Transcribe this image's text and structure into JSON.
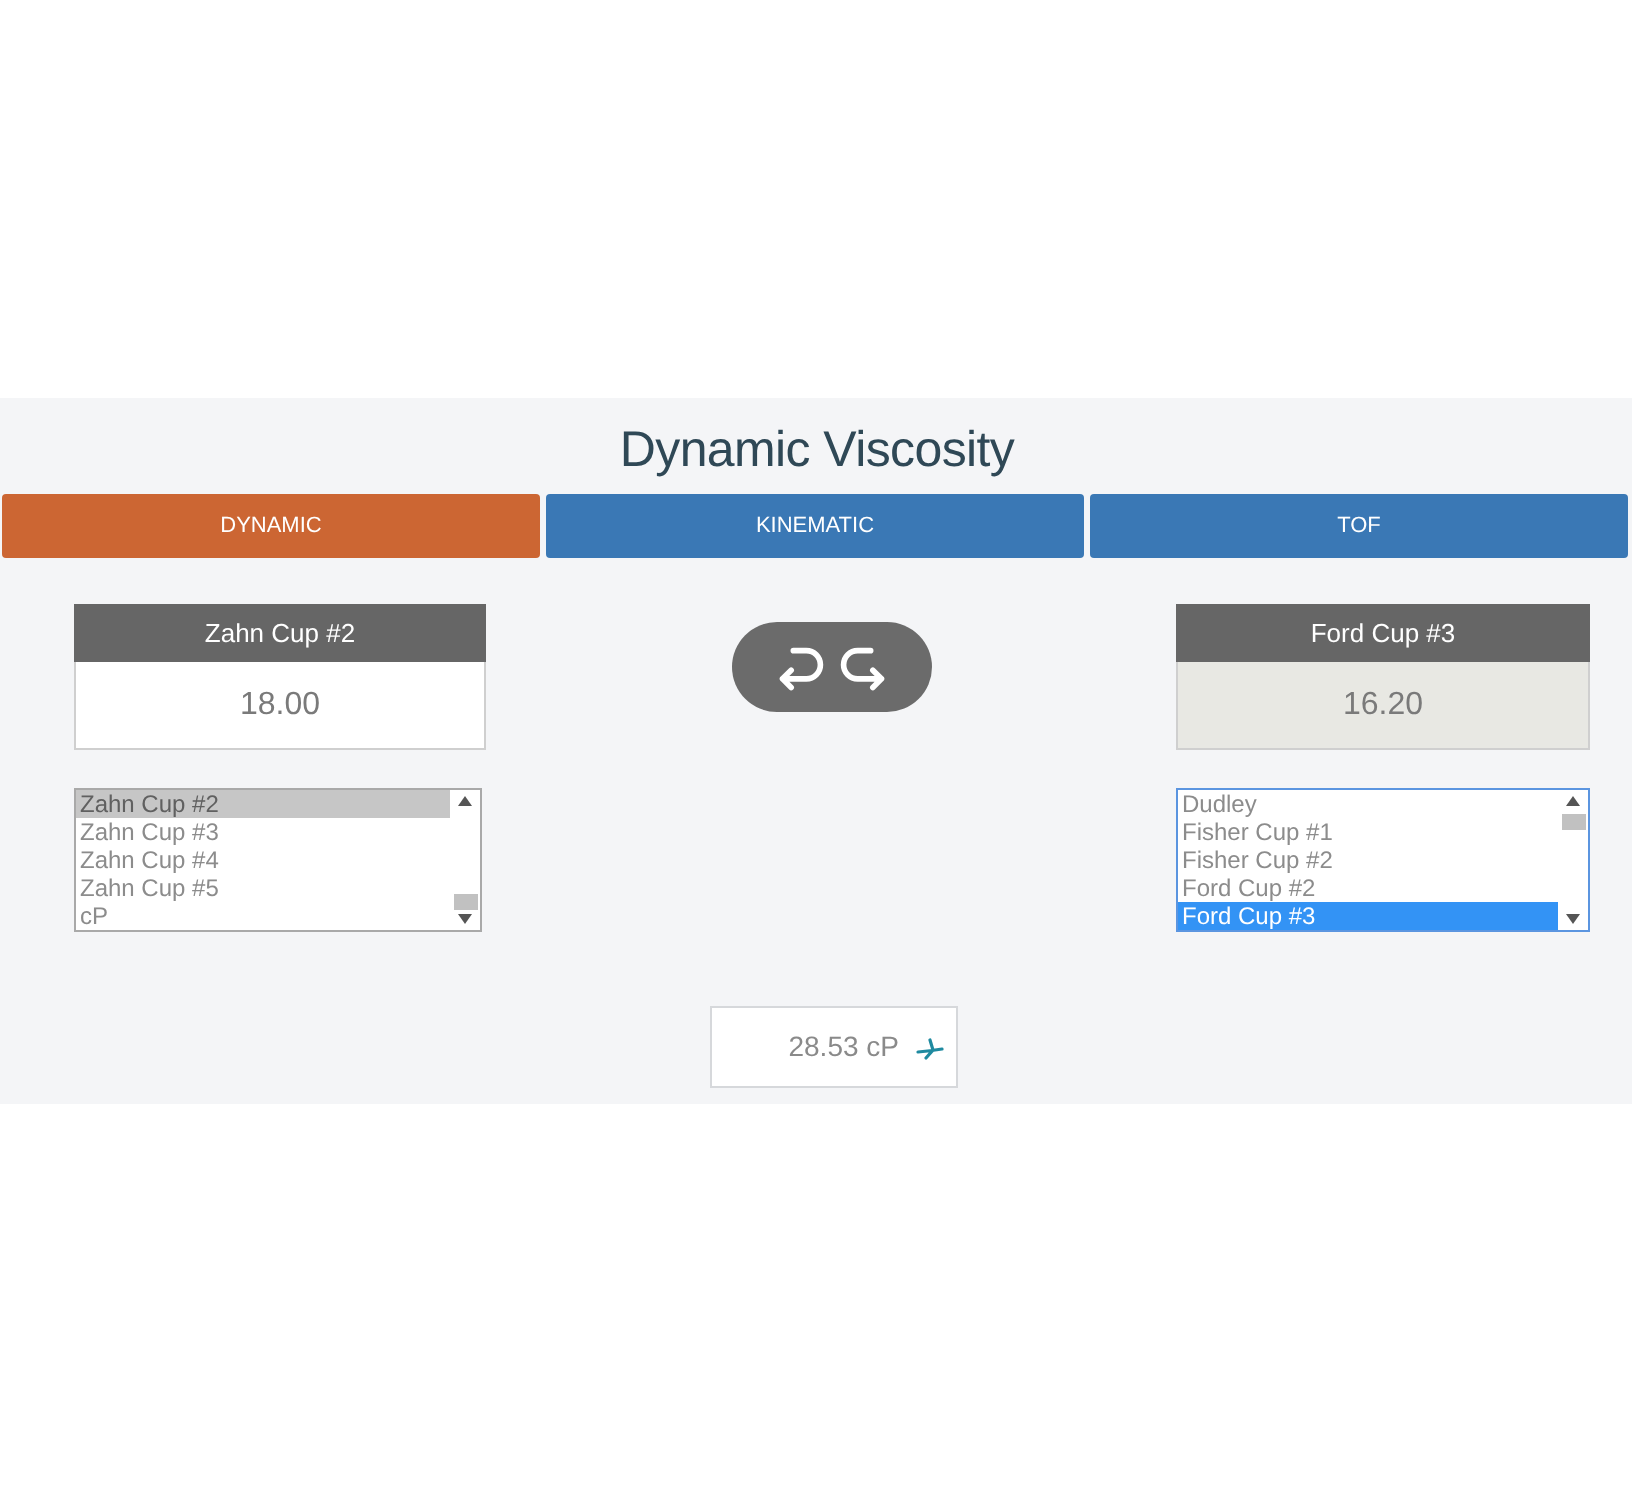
{
  "title": "Dynamic Viscosity",
  "tabs": [
    {
      "label": "DYNAMIC",
      "selected": true
    },
    {
      "label": "KINEMATIC",
      "selected": false
    },
    {
      "label": "TOF",
      "selected": false
    }
  ],
  "converters": [
    {
      "header": "Zahn Cup #2",
      "value": "18.00",
      "readonly": false,
      "focused": false,
      "options": [
        {
          "label": "Zahn Cup #2",
          "selected": true
        },
        {
          "label": "Zahn Cup #3",
          "selected": false
        },
        {
          "label": "Zahn Cup #4",
          "selected": false
        },
        {
          "label": "Zahn Cup #5",
          "selected": false
        },
        {
          "label": "cP",
          "selected": false
        }
      ]
    },
    {
      "header": "Ford Cup #3",
      "value": "16.20",
      "readonly": true,
      "focused": true,
      "options": [
        {
          "label": "Dudley",
          "selected": false
        },
        {
          "label": "Fisher Cup #1",
          "selected": false
        },
        {
          "label": "Fisher Cup #2",
          "selected": false
        },
        {
          "label": "Ford Cup #2",
          "selected": false
        },
        {
          "label": "Ford Cup #3",
          "selected": true
        }
      ]
    }
  ],
  "result": {
    "value": "28.53 cP"
  }
}
